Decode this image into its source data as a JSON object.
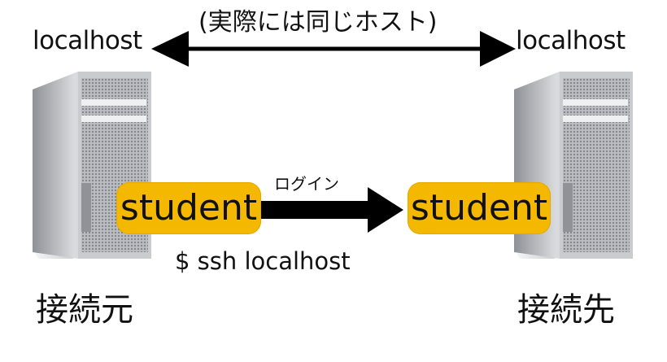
{
  "diagram": {
    "top_caption": "(実際には同じホスト)",
    "left_host_label": "localhost",
    "right_host_label": "localhost",
    "left_user": "student",
    "right_user": "student",
    "login_label": "ログイン",
    "command_label": "$ ssh localhost",
    "source_label": "接続元",
    "destination_label": "接続先"
  },
  "icons": {
    "left_computer": "mac-pro-tower-icon",
    "right_computer": "mac-pro-tower-icon"
  },
  "colors": {
    "user_highlight": "#f5b800",
    "arrow": "#000000"
  }
}
